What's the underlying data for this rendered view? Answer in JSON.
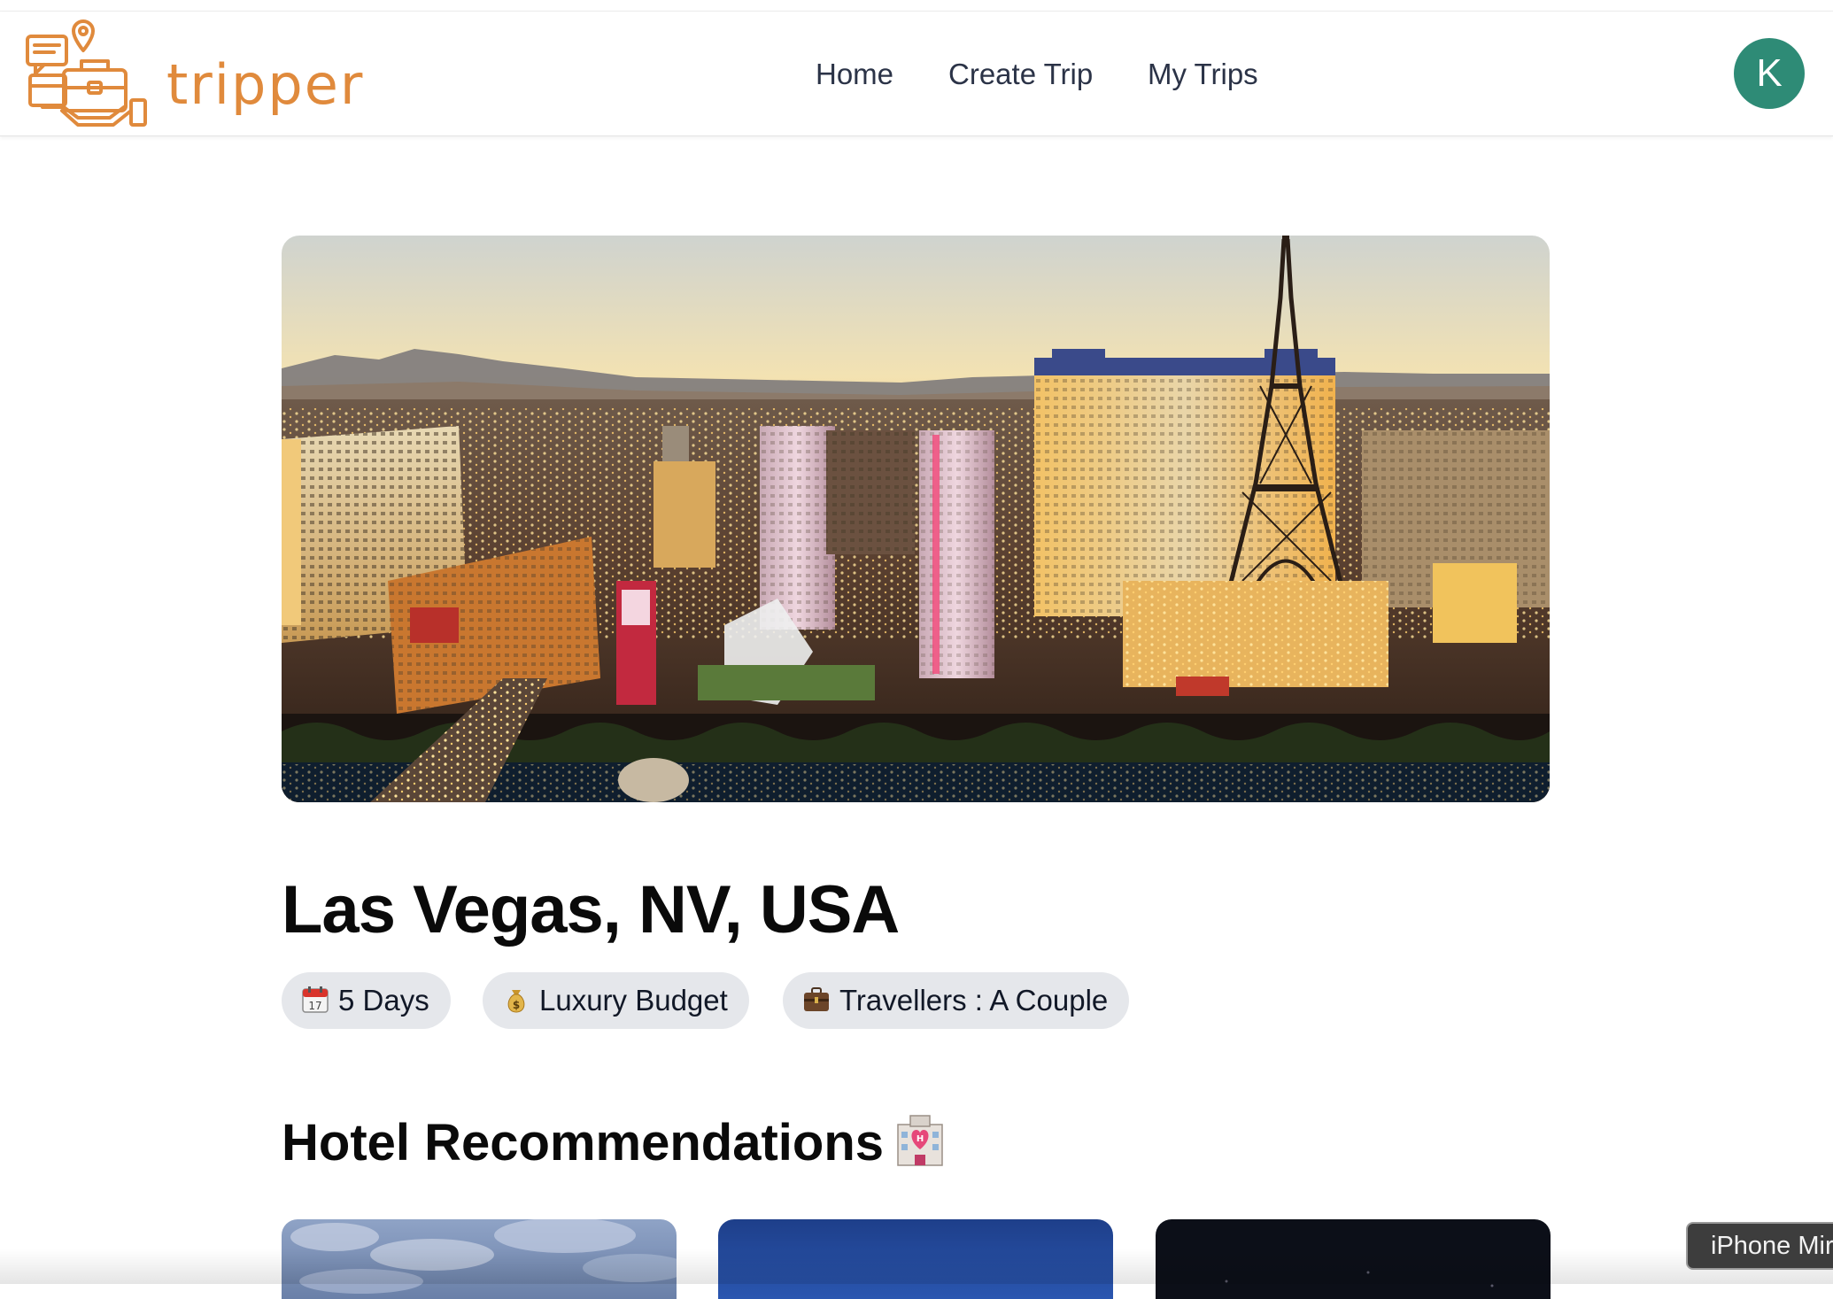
{
  "app": {
    "brand_name": "tripper",
    "brand_color": "#e08a3c",
    "logo_icon": "travel-planner-logo-icon"
  },
  "nav": {
    "items": [
      {
        "label": "Home"
      },
      {
        "label": "Create Trip"
      },
      {
        "label": "My Trips"
      }
    ]
  },
  "user": {
    "avatar_initial": "K",
    "avatar_color": "#2e8b76"
  },
  "trip": {
    "hero_image_subject": "las-vegas-strip-skyline-photo",
    "location": "Las Vegas, NV, USA",
    "tags": [
      {
        "icon": "calendar-icon",
        "label": "5 Days"
      },
      {
        "icon": "money-bag-icon",
        "label": "Luxury Budget"
      },
      {
        "icon": "briefcase-icon",
        "label": "Travellers : A Couple"
      }
    ]
  },
  "hotels": {
    "section_title": "Hotel Recommendations",
    "section_icon": "love-hotel-icon",
    "cards_visible": 3
  },
  "overlay": {
    "tooltip_text": "iPhone Mir"
  }
}
